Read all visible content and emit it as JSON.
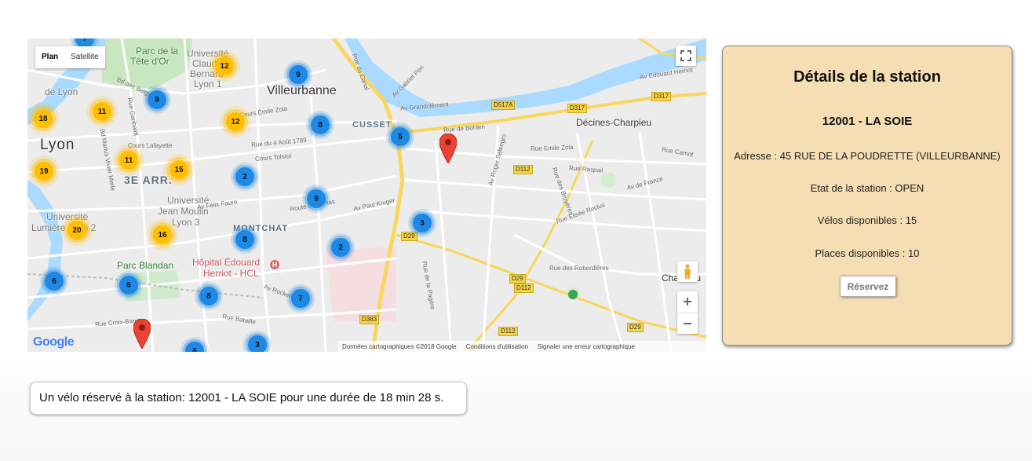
{
  "map": {
    "type_control": {
      "plan": "Plan",
      "satellite": "Satellite"
    },
    "places": [
      {
        "text": "Villeurbanne",
        "name": "place-villeurbanne"
      },
      {
        "text": "Lyon",
        "name": "place-lyon"
      },
      {
        "text": "Décines-Charpieu",
        "name": "place-decines"
      },
      {
        "text": "CUSSET",
        "name": "place-cusset"
      },
      {
        "text": "MONTCHAT",
        "name": "place-montchat"
      },
      {
        "text": "3E ARR.",
        "name": "place-3e"
      },
      {
        "text": "Parc Blandan",
        "name": "place-parc-blandan"
      },
      {
        "text": "Hôpital Édouard",
        "name": "place-hopital-1"
      },
      {
        "text": "Herriot - HCL",
        "name": "place-hopital-2"
      },
      {
        "text": "Université",
        "name": "place-univ-claude-1"
      },
      {
        "text": "Claude",
        "name": "place-univ-claude-2"
      },
      {
        "text": "Bernard",
        "name": "place-univ-claude-3"
      },
      {
        "text": "Lyon 1",
        "name": "place-univ-claude-4"
      },
      {
        "text": "Université",
        "name": "place-univ-jm-1"
      },
      {
        "text": "Jean Moulin",
        "name": "place-univ-jm-2"
      },
      {
        "text": "Lyon 3",
        "name": "place-univ-jm-3"
      },
      {
        "text": "Université",
        "name": "place-univ-lum-1"
      },
      {
        "text": "Lumière Lyon 2",
        "name": "place-univ-lum-2"
      },
      {
        "text": "Parc de la",
        "name": "place-parc-tete-1"
      },
      {
        "text": "Tête d'Or",
        "name": "place-parc-tete-2"
      },
      {
        "text": "de Lyon",
        "name": "place-de-lyon"
      },
      {
        "text": "Chassieu",
        "name": "place-chassieu"
      }
    ],
    "streets": [
      "Cours Émile Zola",
      "Rue du 4 Août 1789",
      "Cours Tolstoï",
      "Route de Genas",
      "Av Paul Kruger",
      "Av Félix Faure",
      "Cours Lafayette",
      "Av Grandclément",
      "Rue de Bohlen",
      "Rue Emile Zola",
      "Rue Raspail",
      "Av de France",
      "Rue Elisée Reclus",
      "Rue des Roberdières",
      "Av Edouard Herriot",
      "Rue du Canal",
      "Av Gabriel Péri",
      "Av Roger Salengro",
      "Rue des Bruyères",
      "Rue Camot",
      "Av Rockefeller",
      "Rue Bataille",
      "Rue Croix-Barret",
      "Bd des Belges",
      "Rue Garibaldi",
      "Bd Marius Vivier Merle",
      "Rue de la Pagère"
    ],
    "roads": [
      "D517A",
      "D317",
      "D317",
      "D112",
      "D29",
      "D29",
      "D112",
      "D383",
      "D112",
      "D29"
    ],
    "clusters": [
      {
        "count": "9",
        "color": "blue"
      },
      {
        "count": "9",
        "color": "blue"
      },
      {
        "count": "8",
        "color": "blue"
      },
      {
        "count": "5",
        "color": "blue"
      },
      {
        "count": "2",
        "color": "blue"
      },
      {
        "count": "9",
        "color": "blue"
      },
      {
        "count": "3",
        "color": "blue"
      },
      {
        "count": "8",
        "color": "blue"
      },
      {
        "count": "2",
        "color": "blue"
      },
      {
        "count": "6",
        "color": "blue"
      },
      {
        "count": "6",
        "color": "blue"
      },
      {
        "count": "8",
        "color": "blue"
      },
      {
        "count": "7",
        "color": "blue"
      },
      {
        "count": "3",
        "color": "blue"
      },
      {
        "count": "6",
        "color": "blue"
      },
      {
        "count": "7",
        "color": "blue"
      },
      {
        "count": "12",
        "color": "yellow"
      },
      {
        "count": "18",
        "color": "yellow"
      },
      {
        "count": "11",
        "color": "yellow"
      },
      {
        "count": "12",
        "color": "yellow"
      },
      {
        "count": "11",
        "color": "yellow"
      },
      {
        "count": "19",
        "color": "yellow"
      },
      {
        "count": "15",
        "color": "yellow"
      },
      {
        "count": "20",
        "color": "yellow"
      },
      {
        "count": "16",
        "color": "yellow"
      }
    ],
    "footer": {
      "data": "Données cartographiques ©2018 Google",
      "terms": "Conditions d'utilisation",
      "report": "Signaler une erreur cartographique"
    },
    "google_logo": "Google",
    "colors": {
      "cluster_blue": "#1e88e5",
      "cluster_yellow": "#ffbf00",
      "pin": "#ea4335",
      "water": "#aadaff",
      "park": "#c5e8c5"
    },
    "icons": [
      "fullscreen-icon",
      "pegman-icon",
      "zoom-in-icon",
      "zoom-out-icon",
      "marker-pin-icon"
    ]
  },
  "details": {
    "title": "Détails de la station",
    "station_name": "12001 - LA SOIE",
    "address": "Adresse : 45 RUE DE LA POUDRETTE (VILLEURBANNE)",
    "status": "Etat de la station : OPEN",
    "bikes": "Vélos disponibles : 15",
    "places": "Places disponibles : 10",
    "reserve_label": "Réservez",
    "panel_color": "#f5deb3"
  },
  "reservation": {
    "message": "Un vélo réservé à la station: 12001 - LA SOIE pour une durée de 18 min 28 s."
  }
}
